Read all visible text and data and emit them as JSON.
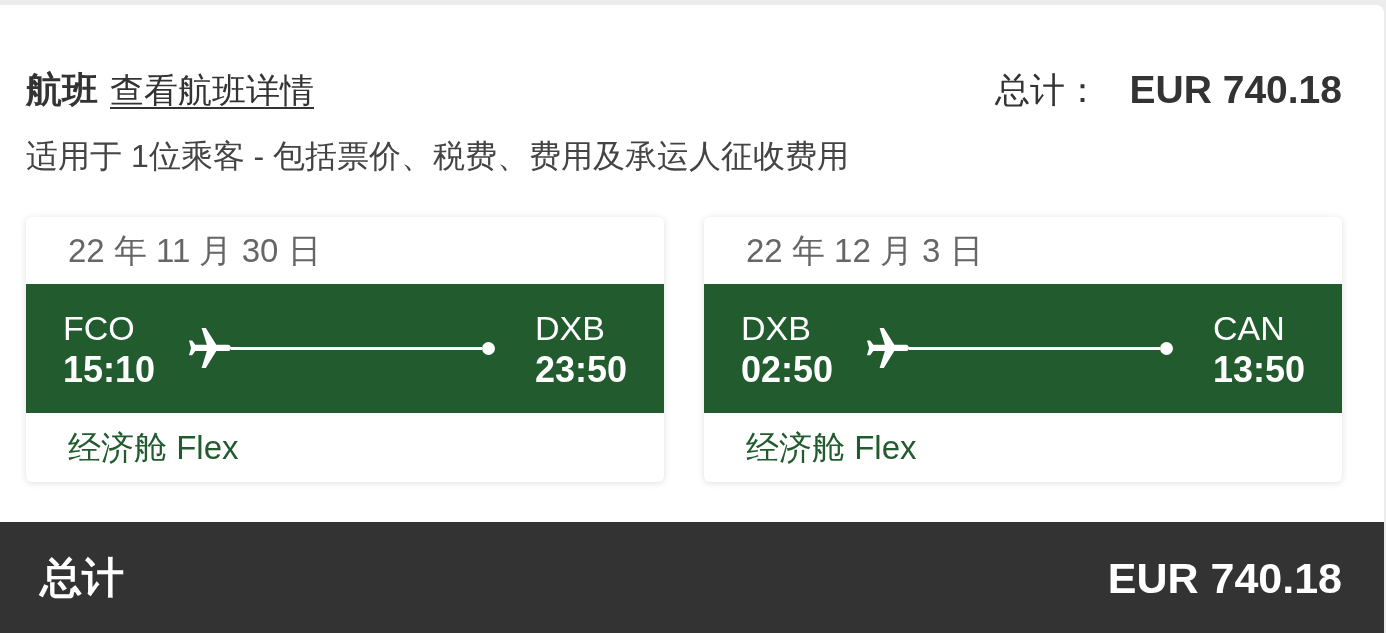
{
  "header": {
    "title": "航班",
    "details_link": "查看航班详情",
    "total_label": "总计：",
    "total_amount": "EUR 740.18"
  },
  "subtitle": "适用于 1位乘客 - 包括票价、税费、费用及承运人征收费用",
  "flights": [
    {
      "date": "22 年 11 月 30 日",
      "origin": {
        "code": "FCO",
        "time": "15:10"
      },
      "destination": {
        "code": "DXB",
        "time": "23:50"
      },
      "cabin": "经济舱 Flex"
    },
    {
      "date": "22 年 12 月 3 日",
      "origin": {
        "code": "DXB",
        "time": "02:50"
      },
      "destination": {
        "code": "CAN",
        "time": "13:50"
      },
      "cabin": "经济舱 Flex"
    }
  ],
  "footer": {
    "label": "总计",
    "amount": "EUR 740.18"
  }
}
